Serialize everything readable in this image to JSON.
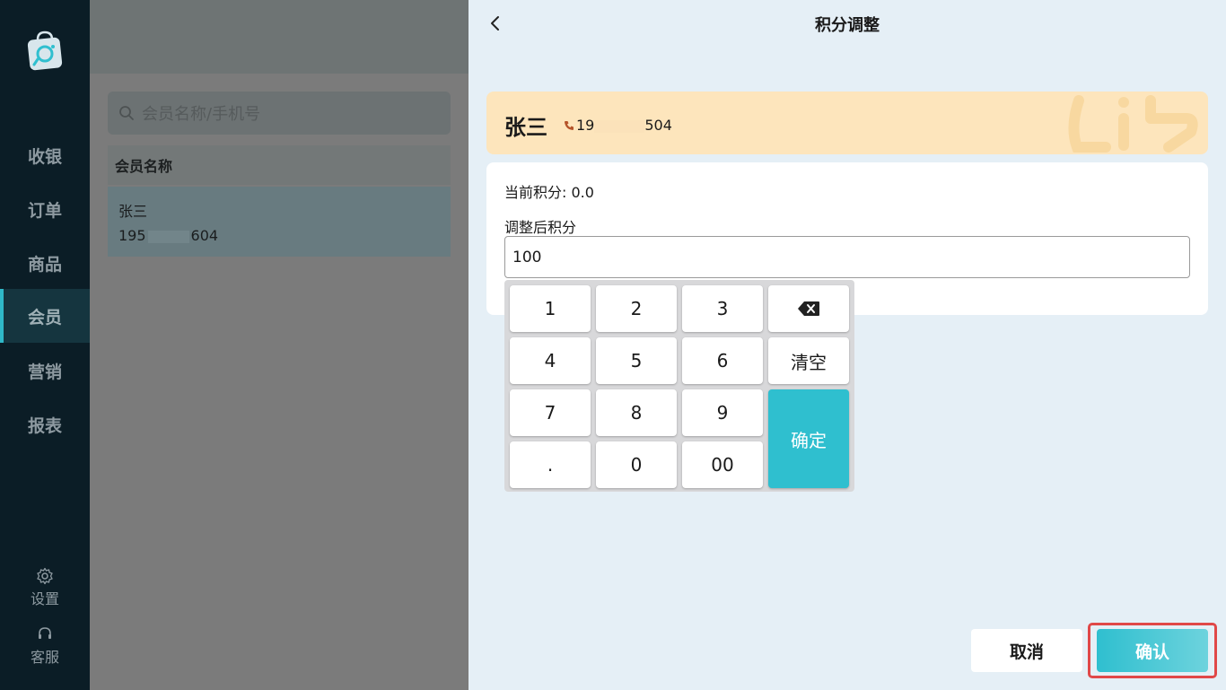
{
  "sidebar": {
    "nav": [
      {
        "label": "收银"
      },
      {
        "label": "订单"
      },
      {
        "label": "商品"
      },
      {
        "label": "会员"
      },
      {
        "label": "营销"
      },
      {
        "label": "报表"
      }
    ],
    "active": "会员",
    "settings_label": "设置",
    "service_label": "客服"
  },
  "member_list": {
    "search_placeholder": "会员名称/手机号",
    "column_header": "会员名称",
    "rows": [
      {
        "name": "张三",
        "phone_prefix": "195",
        "phone_suffix": "604"
      }
    ]
  },
  "panel": {
    "title": "积分调整",
    "member": {
      "name": "张三",
      "phone_prefix": "19",
      "phone_suffix": "504"
    },
    "current_points": "当前积分: 0.0",
    "adjust_label": "调整后积分",
    "adjust_value": "100",
    "keypad": {
      "k1": "1",
      "k2": "2",
      "k3": "3",
      "k4": "4",
      "k5": "5",
      "k6": "6",
      "k7": "7",
      "k8": "8",
      "k9": "9",
      "kdot": ".",
      "k0": "0",
      "k00": "00",
      "clear": "清空",
      "confirm": "确定"
    },
    "cancel_label": "取消",
    "confirm_label": "确认"
  },
  "colors": {
    "accent": "#2fbfcf",
    "sidebar_bg": "#0b1d26",
    "panel_bg": "#e5eff6",
    "member_card_bg": "#fde5bc",
    "highlight_border": "#e04848"
  },
  "icons": [
    "logo-icon",
    "settings-gear-icon",
    "headset-icon",
    "search-icon",
    "back-chevron-icon",
    "phone-icon",
    "backspace-icon"
  ]
}
